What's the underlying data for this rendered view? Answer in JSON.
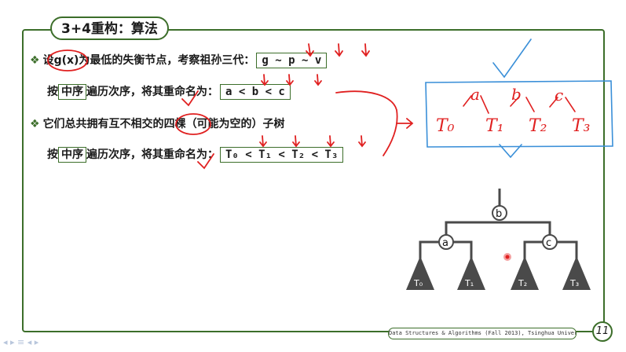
{
  "slide": {
    "title": "3+4重构：算法",
    "line1": {
      "bullet": "❖",
      "pre": "设",
      "circled": "g(x)",
      "post": "为最低的失衡节点，考察祖孙三代：",
      "box": "g ~ p ~ v"
    },
    "line2": {
      "pre": "按",
      "kw": "中序",
      "post": "遍历次序，将其重命名为：",
      "box": "a < b < c"
    },
    "line3": {
      "bullet": "❖",
      "pre": "它们总共拥有互不相交的",
      "circled": "四棵",
      "post": "（可能为空的）子树"
    },
    "line4": {
      "pre": "按",
      "kw": "中序",
      "post": "遍历次序，将其重命名为：",
      "box": "T₀ < T₁ < T₂ < T₃"
    },
    "footer": "Data Structures & Algorithms (Fall 2013), Tsinghua University",
    "page_number": "11"
  },
  "handwriting": {
    "nodes": [
      "a",
      "b",
      "c"
    ],
    "subtrees": [
      "T₀",
      "T₁",
      "T₂",
      "T₃"
    ]
  },
  "tree": {
    "root": "b",
    "left": "a",
    "right": "c",
    "leaves": [
      "T₀",
      "T₁",
      "T₂",
      "T₃"
    ]
  },
  "colors": {
    "frame": "#3c6e2a",
    "ink_red": "#e02020",
    "ink_blue": "#3a8fd8",
    "tree_fill": "#4a4a4a"
  },
  "icons": [
    "bullet-diamond-icon",
    "checkmark-icon",
    "arrow-icon",
    "cursor-dot-icon",
    "nav-arrows-icon"
  ]
}
